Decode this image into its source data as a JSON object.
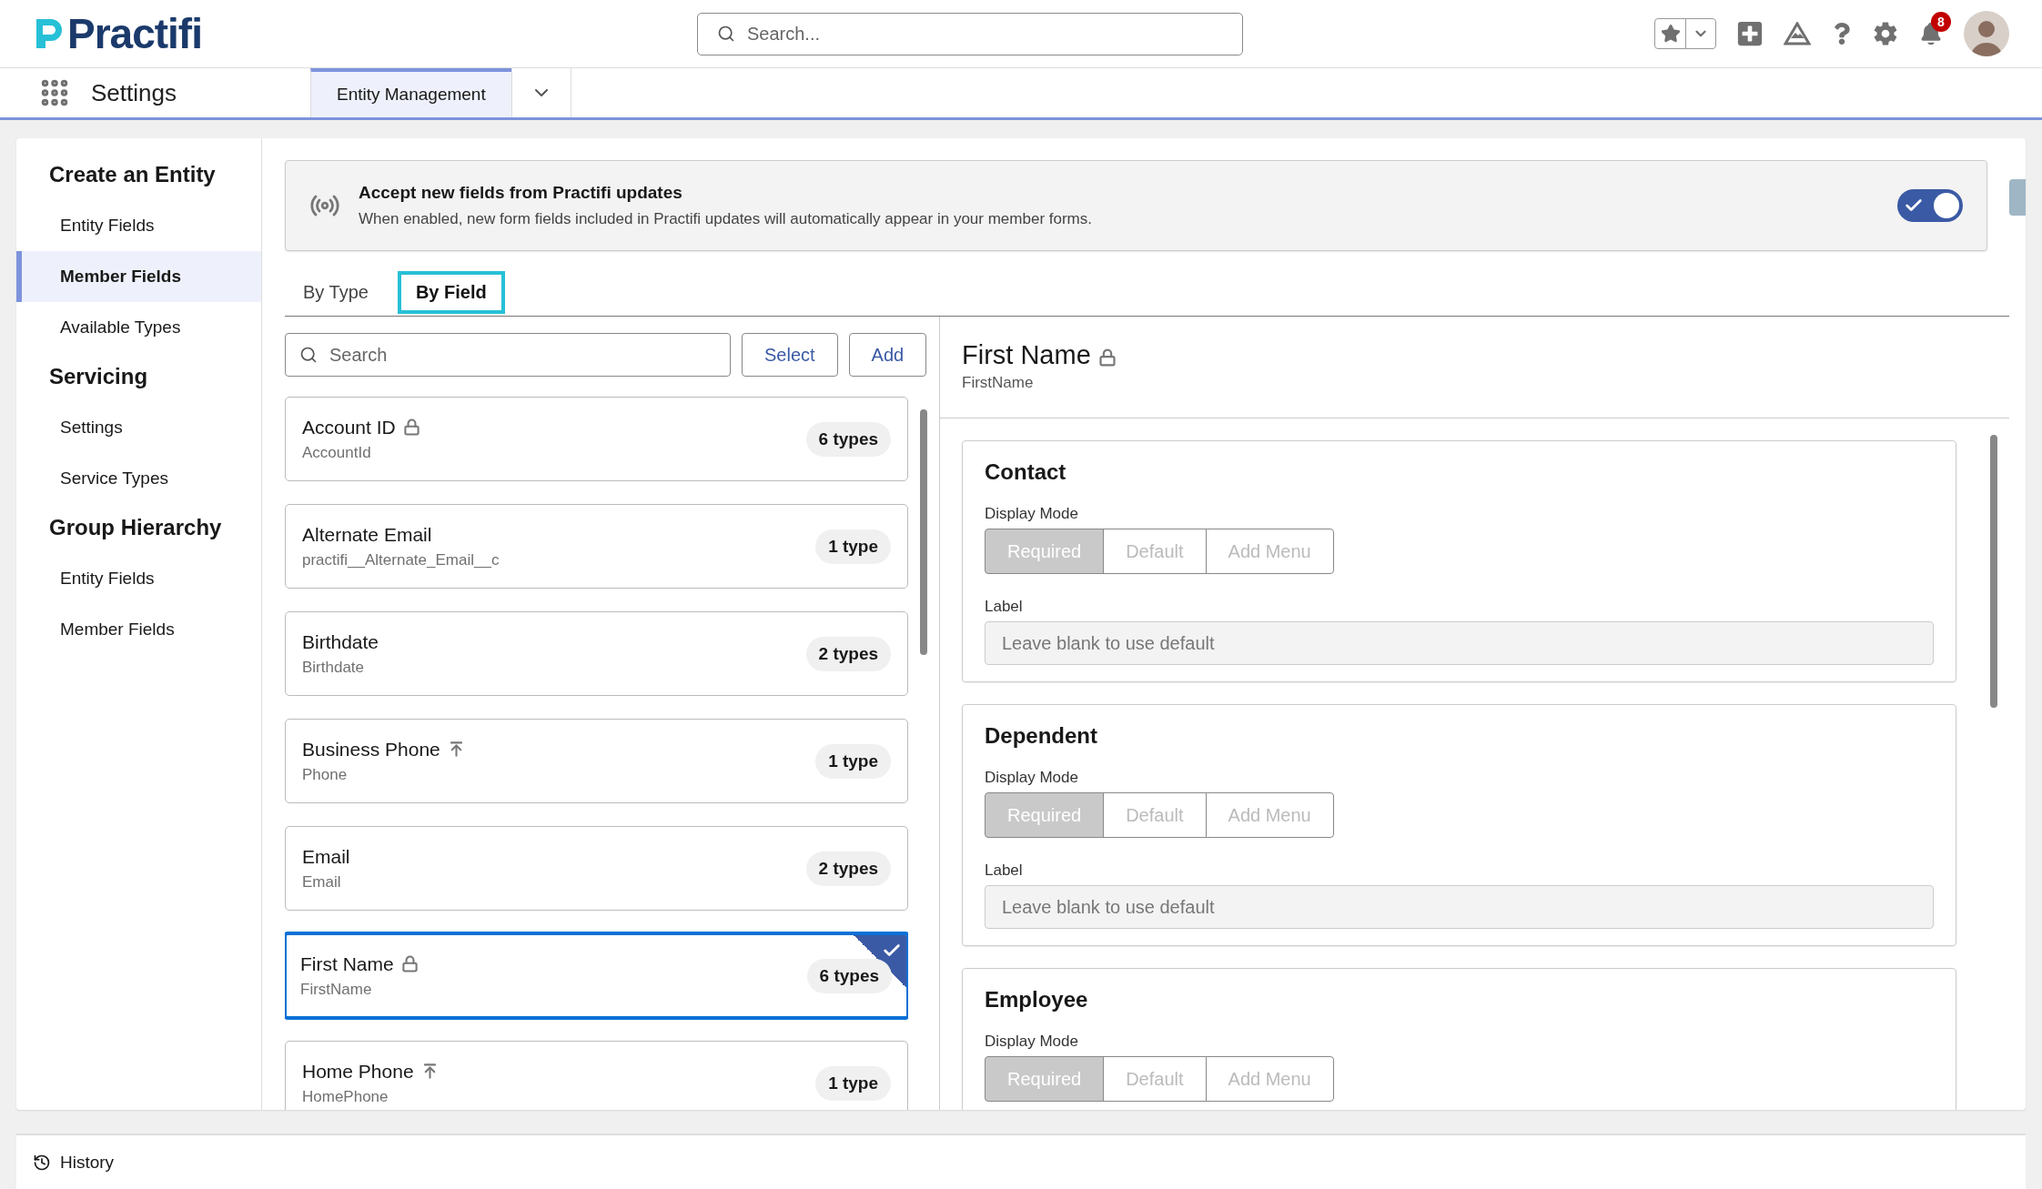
{
  "header": {
    "logo": "Practifi",
    "search": {
      "placeholder": "Search..."
    },
    "notifications": "8"
  },
  "nav": {
    "app_name": "Settings",
    "tabs": [
      {
        "label": "Entity Management",
        "selected": true
      }
    ]
  },
  "sidebar": {
    "sections": [
      {
        "title": "Create an Entity",
        "items": [
          {
            "label": "Entity Fields",
            "selected": false
          },
          {
            "label": "Member Fields",
            "selected": true
          },
          {
            "label": "Available Types",
            "selected": false
          }
        ]
      },
      {
        "title": "Servicing",
        "items": [
          {
            "label": "Settings",
            "selected": false
          },
          {
            "label": "Service Types",
            "selected": false
          }
        ]
      },
      {
        "title": "Group Hierarchy",
        "items": [
          {
            "label": "Entity Fields",
            "selected": false
          },
          {
            "label": "Member Fields",
            "selected": false
          }
        ]
      }
    ]
  },
  "banner": {
    "title": "Accept new fields from Practifi updates",
    "text": "When enabled, new form fields included in Practifi updates will automatically appear in your member forms.",
    "on": true
  },
  "view_tabs": [
    {
      "label": "By Type",
      "selected": false
    },
    {
      "label": "By Field",
      "selected": true
    }
  ],
  "list": {
    "search": {
      "placeholder": "Search"
    },
    "buttons": [
      "Select",
      "Add"
    ],
    "fields": [
      {
        "name": "Account ID",
        "api_name": "AccountId",
        "kind": "locked",
        "count": "6 types",
        "selected": false
      },
      {
        "name": "Alternate Email",
        "api_name": "practifi__Alternate_Email__c",
        "kind": "plain",
        "count": "1 type",
        "selected": false
      },
      {
        "name": "Birthdate",
        "api_name": "Birthdate",
        "kind": "plain",
        "count": "2 types",
        "selected": false
      },
      {
        "name": "Business Phone",
        "api_name": "Phone",
        "kind": "promoted",
        "count": "1 type",
        "selected": false
      },
      {
        "name": "Email",
        "api_name": "Email",
        "kind": "plain",
        "count": "2 types",
        "selected": false
      },
      {
        "name": "First Name",
        "api_name": "FirstName",
        "kind": "locked",
        "count": "6 types",
        "selected": true
      },
      {
        "name": "Home Phone",
        "api_name": "HomePhone",
        "kind": "promoted",
        "count": "1 type",
        "selected": false
      }
    ]
  },
  "detail": {
    "title": "First Name",
    "locked": true,
    "api_name": "FirstName",
    "sections": [
      {
        "title": "Contact",
        "mode_label": "Display Mode",
        "modes": [
          {
            "label": "Required",
            "selected": true
          },
          {
            "label": "Default",
            "selected": false
          },
          {
            "label": "Add Menu",
            "selected": false
          }
        ],
        "label_label": "Label",
        "placeholder": "Leave blank to use default"
      },
      {
        "title": "Dependent",
        "mode_label": "Display Mode",
        "modes": [
          {
            "label": "Required",
            "selected": true
          },
          {
            "label": "Default",
            "selected": false
          },
          {
            "label": "Add Menu",
            "selected": false
          }
        ],
        "label_label": "Label",
        "placeholder": "Leave blank to use default"
      },
      {
        "title": "Employee",
        "mode_label": "Display Mode",
        "modes": [
          {
            "label": "Required",
            "selected": true
          },
          {
            "label": "Default",
            "selected": false
          },
          {
            "label": "Add Menu",
            "selected": false
          }
        ]
      }
    ]
  },
  "footer": {
    "label": "History"
  }
}
